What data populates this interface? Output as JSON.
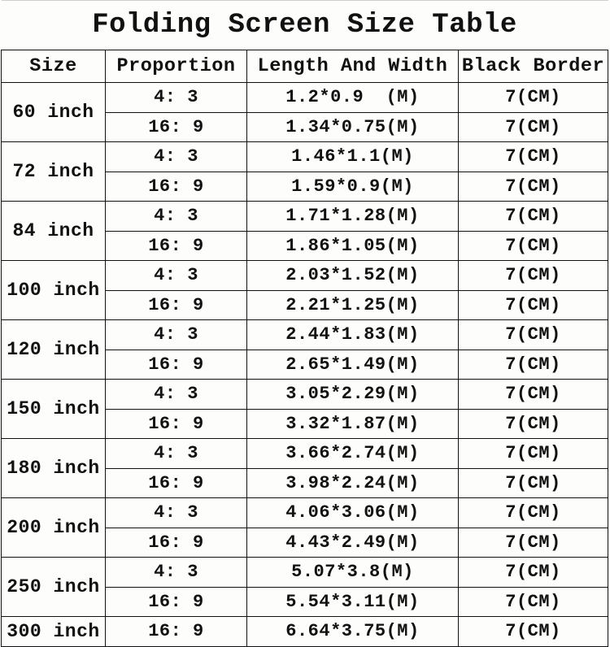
{
  "title": "Folding Screen Size Table",
  "columns": {
    "size": "Size",
    "proportion": "Proportion",
    "length_and_width": "Length And Width",
    "black_border": "Black Border"
  },
  "groups": [
    {
      "size": "60 inch",
      "rows": [
        {
          "proportion": "4: 3",
          "length_and_width": "1.2*0.9  (M)",
          "black_border": "7(CM)"
        },
        {
          "proportion": "16: 9",
          "length_and_width": "1.34*0.75(M)",
          "black_border": "7(CM)"
        }
      ]
    },
    {
      "size": "72 inch",
      "rows": [
        {
          "proportion": "4: 3",
          "length_and_width": "1.46*1.1(M)",
          "black_border": "7(CM)"
        },
        {
          "proportion": "16: 9",
          "length_and_width": "1.59*0.9(M)",
          "black_border": "7(CM)"
        }
      ]
    },
    {
      "size": "84 inch",
      "rows": [
        {
          "proportion": "4: 3",
          "length_and_width": "1.71*1.28(M)",
          "black_border": "7(CM)"
        },
        {
          "proportion": "16: 9",
          "length_and_width": "1.86*1.05(M)",
          "black_border": "7(CM)"
        }
      ]
    },
    {
      "size": "100 inch",
      "rows": [
        {
          "proportion": "4: 3",
          "length_and_width": "2.03*1.52(M)",
          "black_border": "7(CM)"
        },
        {
          "proportion": "16: 9",
          "length_and_width": "2.21*1.25(M)",
          "black_border": "7(CM)"
        }
      ]
    },
    {
      "size": "120 inch",
      "rows": [
        {
          "proportion": "4: 3",
          "length_and_width": "2.44*1.83(M)",
          "black_border": "7(CM)"
        },
        {
          "proportion": "16: 9",
          "length_and_width": "2.65*1.49(M)",
          "black_border": "7(CM)"
        }
      ]
    },
    {
      "size": "150 inch",
      "rows": [
        {
          "proportion": "4: 3",
          "length_and_width": "3.05*2.29(M)",
          "black_border": "7(CM)"
        },
        {
          "proportion": "16: 9",
          "length_and_width": "3.32*1.87(M)",
          "black_border": "7(CM)"
        }
      ]
    },
    {
      "size": "180 inch",
      "rows": [
        {
          "proportion": "4: 3",
          "length_and_width": "3.66*2.74(M)",
          "black_border": "7(CM)"
        },
        {
          "proportion": "16: 9",
          "length_and_width": "3.98*2.24(M)",
          "black_border": "7(CM)"
        }
      ]
    },
    {
      "size": "200 inch",
      "rows": [
        {
          "proportion": "4: 3",
          "length_and_width": "4.06*3.06(M)",
          "black_border": "7(CM)"
        },
        {
          "proportion": "16: 9",
          "length_and_width": "4.43*2.49(M)",
          "black_border": "7(CM)"
        }
      ]
    },
    {
      "size": "250 inch",
      "rows": [
        {
          "proportion": "4: 3",
          "length_and_width": "5.07*3.8(M)",
          "black_border": "7(CM)"
        },
        {
          "proportion": "16: 9",
          "length_and_width": "5.54*3.11(M)",
          "black_border": "7(CM)"
        }
      ]
    },
    {
      "size": "300 inch",
      "rows": [
        {
          "proportion": "16: 9",
          "length_and_width": "6.64*3.75(M)",
          "black_border": "7(CM)"
        }
      ]
    }
  ],
  "chart_data": {
    "type": "table",
    "title": "Folding Screen Size Table",
    "columns": [
      "Size",
      "Proportion",
      "Length And Width",
      "Black Border"
    ],
    "rows": [
      [
        "60 inch",
        "4: 3",
        "1.2*0.9  (M)",
        "7(CM)"
      ],
      [
        "60 inch",
        "16: 9",
        "1.34*0.75(M)",
        "7(CM)"
      ],
      [
        "72 inch",
        "4: 3",
        "1.46*1.1(M)",
        "7(CM)"
      ],
      [
        "72 inch",
        "16: 9",
        "1.59*0.9(M)",
        "7(CM)"
      ],
      [
        "84 inch",
        "4: 3",
        "1.71*1.28(M)",
        "7(CM)"
      ],
      [
        "84 inch",
        "16: 9",
        "1.86*1.05(M)",
        "7(CM)"
      ],
      [
        "100 inch",
        "4: 3",
        "2.03*1.52(M)",
        "7(CM)"
      ],
      [
        "100 inch",
        "16: 9",
        "2.21*1.25(M)",
        "7(CM)"
      ],
      [
        "120 inch",
        "4: 3",
        "2.44*1.83(M)",
        "7(CM)"
      ],
      [
        "120 inch",
        "16: 9",
        "2.65*1.49(M)",
        "7(CM)"
      ],
      [
        "150 inch",
        "4: 3",
        "3.05*2.29(M)",
        "7(CM)"
      ],
      [
        "150 inch",
        "16: 9",
        "3.32*1.87(M)",
        "7(CM)"
      ],
      [
        "180 inch",
        "4: 3",
        "3.66*2.74(M)",
        "7(CM)"
      ],
      [
        "180 inch",
        "16: 9",
        "3.98*2.24(M)",
        "7(CM)"
      ],
      [
        "200 inch",
        "4: 3",
        "4.06*3.06(M)",
        "7(CM)"
      ],
      [
        "200 inch",
        "16: 9",
        "4.43*2.49(M)",
        "7(CM)"
      ],
      [
        "250 inch",
        "4: 3",
        "5.07*3.8(M)",
        "7(CM)"
      ],
      [
        "250 inch",
        "16: 9",
        "5.54*3.11(M)",
        "7(CM)"
      ],
      [
        "300 inch",
        "16: 9",
        "6.64*3.75(M)",
        "7(CM)"
      ]
    ]
  }
}
